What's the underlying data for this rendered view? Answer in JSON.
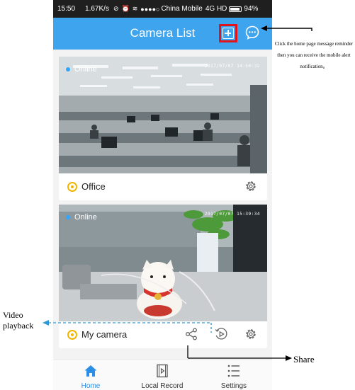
{
  "status_bar": {
    "time": "15:50",
    "speed": "1.67K/s",
    "carrier": "China Mobile",
    "network": "4G HD",
    "battery": "94%"
  },
  "app_bar": {
    "title": "Camera List",
    "add_icon": "add-square-icon",
    "message_icon": "chat-bubble-icon"
  },
  "cameras": [
    {
      "status": "Online",
      "timestamp": "2017/07/07 14:50:32",
      "name": "Office"
    },
    {
      "status": "Online",
      "timestamp": "2017/07/07 15:39:34",
      "name": "My camera"
    }
  ],
  "tabs": [
    {
      "label": "Home",
      "icon": "home-icon",
      "active": true
    },
    {
      "label": "Local Record",
      "icon": "video-file-icon",
      "active": false
    },
    {
      "label": "Settings",
      "icon": "list-menu-icon",
      "active": false
    }
  ],
  "annotations": {
    "message_note": "Click the home page message reminder then you can receive the mobile alert notification。",
    "video_playback": "Video playback",
    "share": "Share"
  },
  "colors": {
    "app_bar": "#3fa4ee",
    "highlight_box": "#e0141b",
    "online_dot": "#2fa6ff",
    "camera_icon": "#f2b500",
    "active_tab": "#2c8ee6"
  }
}
